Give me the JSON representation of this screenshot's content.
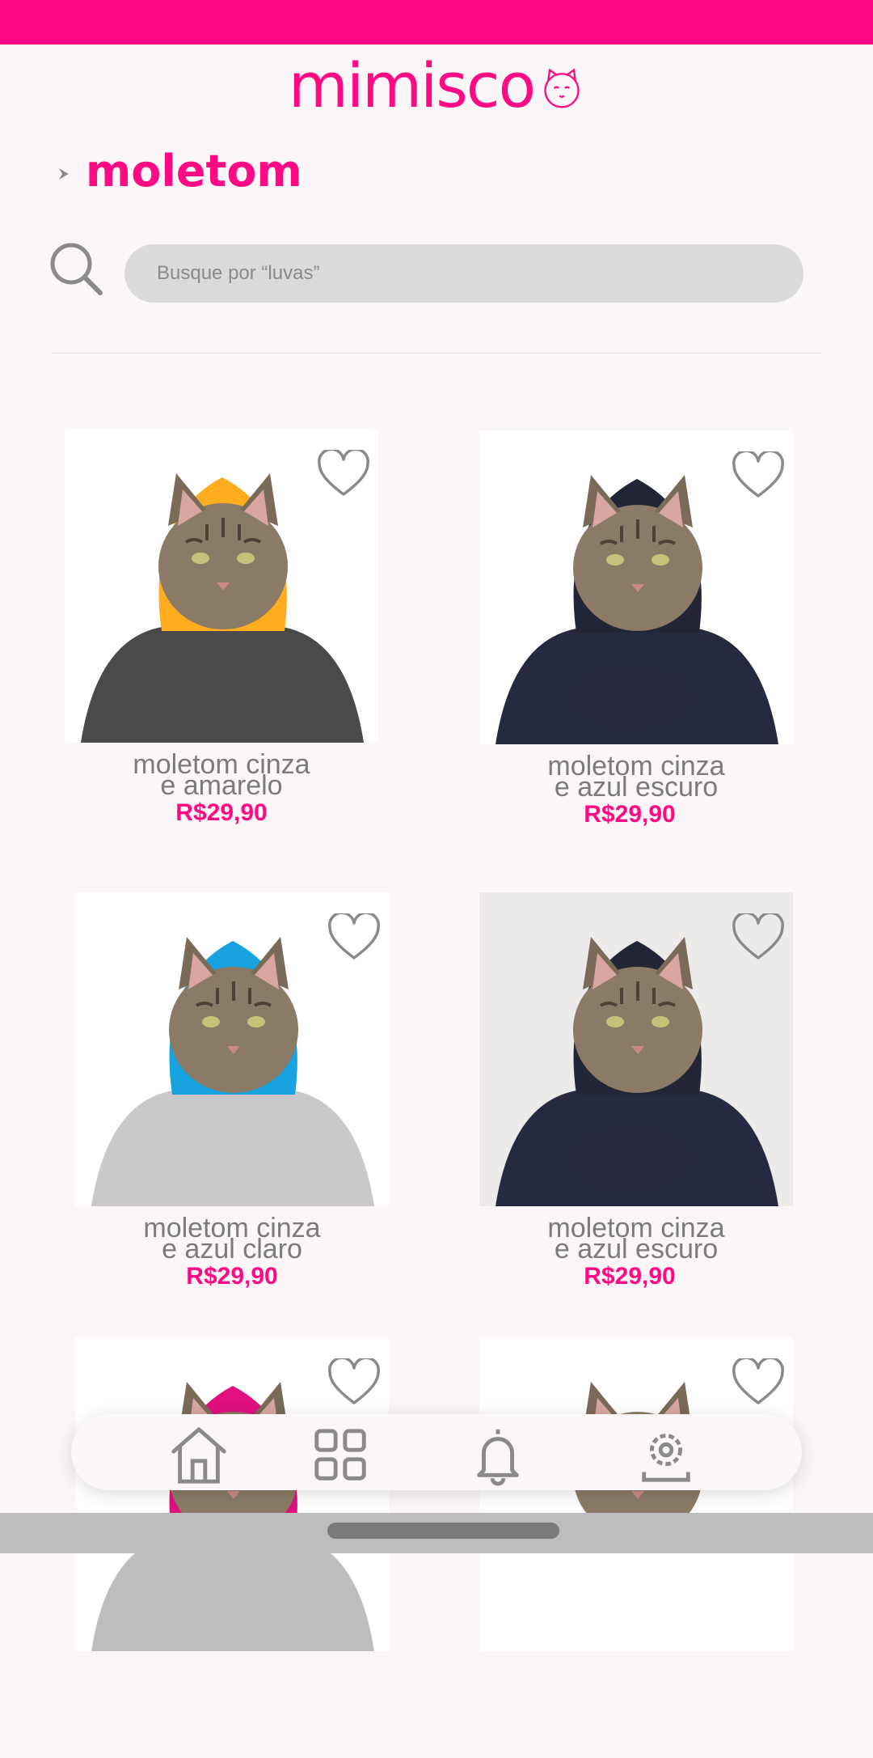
{
  "app": {
    "name": "mimisco"
  },
  "header": {
    "logo_text": "mimisco",
    "logo_icon": "cat-face-icon"
  },
  "page": {
    "title": "moletom",
    "breadcrumb_icon": "chevron-right-icon"
  },
  "search": {
    "placeholder": "Busque por “luvas”",
    "value": "",
    "icon": "search-icon"
  },
  "products": [
    {
      "name": "moletom cinza\ne amarelo",
      "price": "R$29,90",
      "favorite": false,
      "hood_color": "#ffad1f",
      "body_color": "#4a4a4d"
    },
    {
      "name": "moletom cinza\ne azul escuro",
      "price": "R$29,90",
      "favorite": false,
      "hood_color": "#222536",
      "body_color": "#262a40"
    },
    {
      "name": "moletom cinza\ne azul claro",
      "price": "R$29,90",
      "favorite": false,
      "hood_color": "#16a3e0",
      "body_color": "#c9c9cb"
    },
    {
      "name": "moletom cinza\ne azul escuro",
      "price": "R$29,90",
      "favorite": false,
      "hood_color": "#222536",
      "body_color": "#262a40"
    },
    {
      "name": "",
      "price": "",
      "favorite": false,
      "hood_color": "#e0107e",
      "body_color": "#bdbdbd"
    },
    {
      "name": "",
      "price": "",
      "favorite": false,
      "hood_color": "#ffffff",
      "body_color": "#ffffff"
    }
  ],
  "bottom_nav": [
    {
      "icon": "home-icon",
      "label": "home"
    },
    {
      "icon": "grid-icon",
      "label": "categories"
    },
    {
      "icon": "bell-icon",
      "label": "notifications"
    },
    {
      "icon": "settings-icon",
      "label": "settings"
    }
  ],
  "colors": {
    "accent": "#ff0a84",
    "background": "#fbf6f7",
    "text_muted": "#7b7b7b",
    "search_bg": "#dadada",
    "icon_gray": "#8a8a8a"
  }
}
